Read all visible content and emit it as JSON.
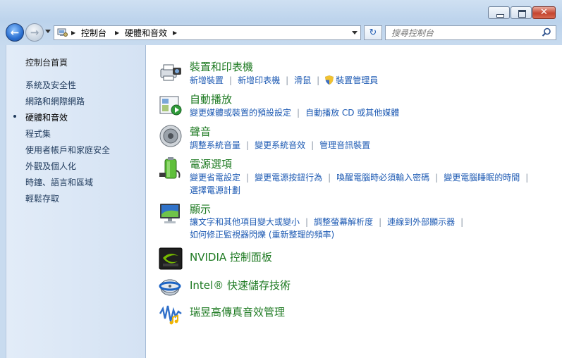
{
  "window": {
    "caption_buttons": {
      "minimize": "minimize",
      "maximize": "maximize",
      "close": "✕"
    }
  },
  "nav": {
    "back_arrow": "←",
    "forward_arrow": "→",
    "breadcrumbs": [
      "控制台",
      "硬體和音效"
    ],
    "refresh_glyph": "↻",
    "search_placeholder": "搜尋控制台"
  },
  "sidebar": {
    "home": "控制台首頁",
    "items": [
      "系統及安全性",
      "網路和網際網路",
      "硬體和音效",
      "程式集",
      "使用者帳戶和家庭安全",
      "外觀及個人化",
      "時鐘、語言和區域",
      "輕鬆存取"
    ],
    "current_index": 2
  },
  "categories": [
    {
      "title": "裝置和印表機",
      "icon": "printer-camera-icon",
      "lines": [
        [
          "新增裝置",
          "新增印表機",
          "滑鼠",
          "裝置管理員"
        ]
      ]
    },
    {
      "title": "自動播放",
      "icon": "autoplay-icon",
      "lines": [
        [
          "變更媒體或裝置的預設設定",
          "自動播放 CD 或其他媒體"
        ]
      ]
    },
    {
      "title": "聲音",
      "icon": "speaker-icon",
      "lines": [
        [
          "調整系統音量",
          "變更系統音效",
          "管理音訊裝置"
        ]
      ]
    },
    {
      "title": "電源選項",
      "icon": "battery-icon",
      "lines": [
        [
          "變更省電設定",
          "變更電源按鈕行為",
          "喚醒電腦時必須輸入密碼",
          "變更電腦睡眠的時間"
        ],
        [
          "選擇電源計劃"
        ]
      ]
    },
    {
      "title": "顯示",
      "icon": "monitor-icon",
      "lines": [
        [
          "讓文字和其他項目變大或變小",
          "調整螢幕解析度",
          "連線到外部顯示器"
        ],
        [
          "如何修正監視器閃爍 (重新整理的頻率)"
        ]
      ]
    },
    {
      "title": "NVIDIA 控制面板",
      "icon": "nvidia-icon",
      "lines": []
    },
    {
      "title": "Intel® 快速儲存技術",
      "icon": "intel-storage-icon",
      "lines": []
    },
    {
      "title": "瑞昱高傳真音效管理",
      "icon": "realtek-audio-icon",
      "lines": []
    }
  ],
  "colors": {
    "link": "#1d5ab3",
    "title": "#1e7a22",
    "sidebar_text": "#1e395b"
  }
}
